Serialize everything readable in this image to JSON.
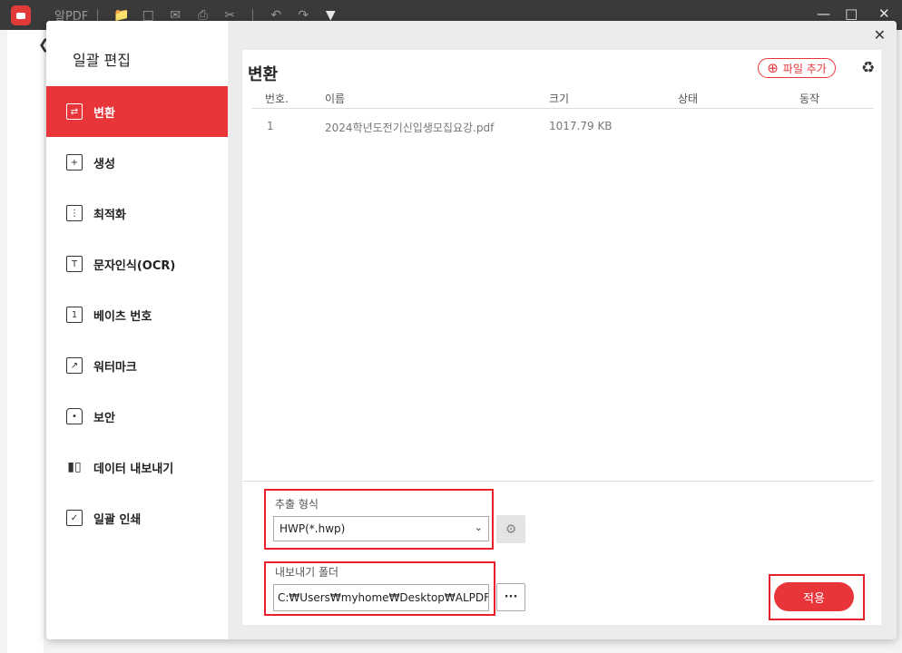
{
  "app": {
    "title": "알PDF",
    "toolbar_icons": [
      "folder-icon",
      "save-icon",
      "mail-icon",
      "print-icon",
      "scissors-icon",
      "undo-icon",
      "redo-icon",
      "dropdown-icon"
    ],
    "window_controls": [
      "minimize",
      "maximize",
      "close"
    ],
    "accent_color": "#e8353a",
    "titlebar_color": "#3a3a3a"
  },
  "dialog": {
    "sidebar": {
      "title": "일괄 편집",
      "items": [
        {
          "label": "변환",
          "icon": "convert-icon",
          "active": true
        },
        {
          "label": "생성",
          "icon": "create-icon",
          "active": false
        },
        {
          "label": "최적화",
          "icon": "optimize-icon",
          "active": false
        },
        {
          "label": "문자인식(OCR)",
          "icon": "ocr-icon",
          "active": false
        },
        {
          "label": "베이츠 번호",
          "icon": "bates-icon",
          "active": false
        },
        {
          "label": "워터마크",
          "icon": "watermark-icon",
          "active": false
        },
        {
          "label": "보안",
          "icon": "lock-icon",
          "active": false
        },
        {
          "label": "데이터 내보내기",
          "icon": "bar-chart-icon",
          "active": false
        },
        {
          "label": "일괄 인쇄",
          "icon": "print-batch-icon",
          "active": false
        }
      ]
    },
    "main": {
      "title": "변환",
      "add_file_label": "파일 추가",
      "table": {
        "headers": [
          "번호.",
          "이름",
          "크기",
          "상태",
          "동작"
        ],
        "rows": [
          {
            "no": "1",
            "name": "2024학년도전기신입생모집요강.pdf",
            "size": "1017.79 KB",
            "status": "",
            "action": ""
          }
        ]
      },
      "format": {
        "label": "추출 형식",
        "value": "HWP(*.hwp)"
      },
      "folder": {
        "label": "내보내기 폴더",
        "value": "C:₩Users₩myhome₩Desktop₩ALPDF₩Cor"
      },
      "browse_label": "···",
      "apply_label": "적용"
    }
  }
}
